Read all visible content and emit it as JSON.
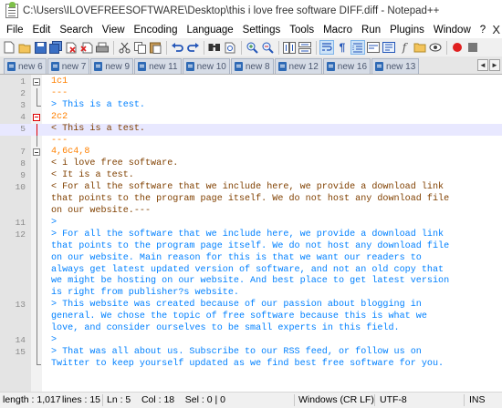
{
  "window": {
    "title": "C:\\Users\\ILOVEFREESOFTWARE\\Desktop\\this i love free software DIFF.diff - Notepad++"
  },
  "menu": [
    "File",
    "Edit",
    "Search",
    "View",
    "Encoding",
    "Language",
    "Settings",
    "Tools",
    "Macro",
    "Run",
    "Plugins",
    "Window",
    "?"
  ],
  "menu_close": "X",
  "toolbar": [
    "new-file",
    "open-file",
    "save",
    "save-all",
    "close",
    "close-all",
    "print",
    "cut",
    "copy",
    "paste",
    "undo",
    "redo",
    "find",
    "replace",
    "zoom-in",
    "zoom-out",
    "sync-vertical",
    "sync-horizontal",
    "word-wrap",
    "show-all-characters",
    "indent-guide",
    "user-language",
    "doc-map",
    "function-list",
    "record-macro",
    "stop-macro",
    "play-macro",
    "run-macro-multiple",
    "save-macro",
    "monitoring",
    "spell-check"
  ],
  "tabs": [
    "new 6",
    "new 7",
    "new 9",
    "new 11",
    "new 10",
    "new 8",
    "new 12",
    "new 16",
    "new 13"
  ],
  "tab_arrow_left": "◄",
  "tab_arrow_right": "►",
  "editor": {
    "current_line": 5,
    "lines": [
      {
        "num": "1",
        "fold": "box",
        "segments": [
          {
            "text": "1c1",
            "style": "hdr"
          }
        ]
      },
      {
        "num": "2",
        "fold": "line",
        "segments": [
          {
            "text": "---",
            "style": "sep"
          }
        ]
      },
      {
        "num": "3",
        "fold": "end",
        "segments": [
          {
            "text": "> This is a test.",
            "style": "add"
          }
        ]
      },
      {
        "num": "4",
        "fold": "box-red",
        "segments": [
          {
            "text": "2c2",
            "style": "hdr"
          }
        ]
      },
      {
        "num": "5",
        "fold": "line-red",
        "segments": [
          {
            "text": "< This is a test.",
            "style": "del"
          }
        ]
      },
      {
        "num": "",
        "fold": "line",
        "segments": [
          {
            "text": "---",
            "style": "sep"
          }
        ]
      },
      {
        "num": "7",
        "fold": "box",
        "segments": [
          {
            "text": "4,6c4,8",
            "style": "hdr"
          }
        ]
      },
      {
        "num": "8",
        "fold": "line",
        "segments": [
          {
            "text": "< i love free software.",
            "style": "del"
          }
        ]
      },
      {
        "num": "9",
        "fold": "line",
        "segments": [
          {
            "text": "< It is a test.",
            "style": "del"
          }
        ]
      },
      {
        "num": "10",
        "fold": "line",
        "segments": [
          {
            "text": "< For all the software that we include here, we provide a download link",
            "style": "del"
          }
        ]
      },
      {
        "num": "",
        "fold": "line",
        "segments": [
          {
            "text": "that points to the program page itself. We do not host any download file",
            "style": "del"
          }
        ]
      },
      {
        "num": "",
        "fold": "line",
        "segments": [
          {
            "text": "on our website.---",
            "style": "del"
          }
        ]
      },
      {
        "num": "11",
        "fold": "line",
        "segments": [
          {
            "text": ">",
            "style": "add"
          }
        ]
      },
      {
        "num": "12",
        "fold": "line",
        "segments": [
          {
            "text": "> For all the software that we include here, we provide a download link",
            "style": "add"
          }
        ]
      },
      {
        "num": "",
        "fold": "line",
        "segments": [
          {
            "text": "that points to the program page itself. We do not host any download file",
            "style": "add"
          }
        ]
      },
      {
        "num": "",
        "fold": "line",
        "segments": [
          {
            "text": "on our website. Main reason for this is that we want our readers to",
            "style": "add"
          }
        ]
      },
      {
        "num": "",
        "fold": "line",
        "segments": [
          {
            "text": "always get latest updated version of software, and not an old copy that",
            "style": "add"
          }
        ]
      },
      {
        "num": "",
        "fold": "line",
        "segments": [
          {
            "text": "we might be hosting on our website. And best place to get latest version",
            "style": "add"
          }
        ]
      },
      {
        "num": "",
        "fold": "line",
        "segments": [
          {
            "text": "is right from publisher?s website.",
            "style": "add"
          }
        ]
      },
      {
        "num": "13",
        "fold": "line",
        "segments": [
          {
            "text": "> This website was created because of our passion about blogging in",
            "style": "add"
          }
        ]
      },
      {
        "num": "",
        "fold": "line",
        "segments": [
          {
            "text": "general. We chose the topic of free software because this is what we",
            "style": "add"
          }
        ]
      },
      {
        "num": "",
        "fold": "line",
        "segments": [
          {
            "text": "love, and consider ourselves to be small experts in this field.",
            "style": "add"
          }
        ]
      },
      {
        "num": "14",
        "fold": "line",
        "segments": [
          {
            "text": ">",
            "style": "add"
          }
        ]
      },
      {
        "num": "15",
        "fold": "line",
        "segments": [
          {
            "text": "> That was all about us. Subscribe to our RSS feed, or follow us on",
            "style": "add"
          }
        ]
      },
      {
        "num": "",
        "fold": "end",
        "segments": [
          {
            "text": "Twitter to keep yourself updated as we find best free software for you.",
            "style": "add"
          }
        ]
      }
    ]
  },
  "status": {
    "length": "length : 1,017",
    "lines": "lines : 15",
    "position": "Ln : 5    Col : 18    Sel : 0 | 0",
    "eol": "Windows (CR LF)",
    "encoding": "UTF-8",
    "mode": "INS"
  },
  "colors": {
    "hunk_header": "#ff8000",
    "added": "#0080ff",
    "removed": "#804000",
    "current_line": "#e8e8ff",
    "fold_marker_active": "#e00000"
  }
}
